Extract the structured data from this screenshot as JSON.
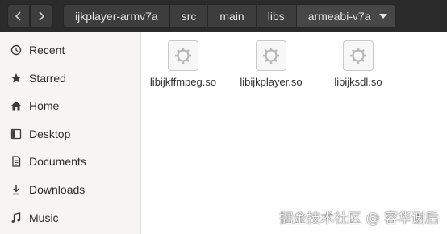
{
  "header": {
    "breadcrumbs": [
      "ijkplayer-armv7a",
      "src",
      "main",
      "libs",
      "armeabi-v7a"
    ]
  },
  "sidebar": {
    "items": [
      {
        "label": "Recent",
        "icon": "clock-icon"
      },
      {
        "label": "Starred",
        "icon": "star-icon"
      },
      {
        "label": "Home",
        "icon": "home-icon"
      },
      {
        "label": "Desktop",
        "icon": "desktop-icon"
      },
      {
        "label": "Documents",
        "icon": "document-icon"
      },
      {
        "label": "Downloads",
        "icon": "download-icon"
      },
      {
        "label": "Music",
        "icon": "music-icon"
      }
    ]
  },
  "files": [
    {
      "name": "libijkffmpeg.so",
      "icon": "shared-library-icon"
    },
    {
      "name": "libijkplayer.so",
      "icon": "shared-library-icon"
    },
    {
      "name": "libijksdl.so",
      "icon": "shared-library-icon"
    }
  ],
  "watermark": "掘金技术社区 @ 容华谢后",
  "colors": {
    "headerbar": "#2b2b2b",
    "button": "#3d3d3d",
    "sidebar": "#f6f5f4"
  }
}
